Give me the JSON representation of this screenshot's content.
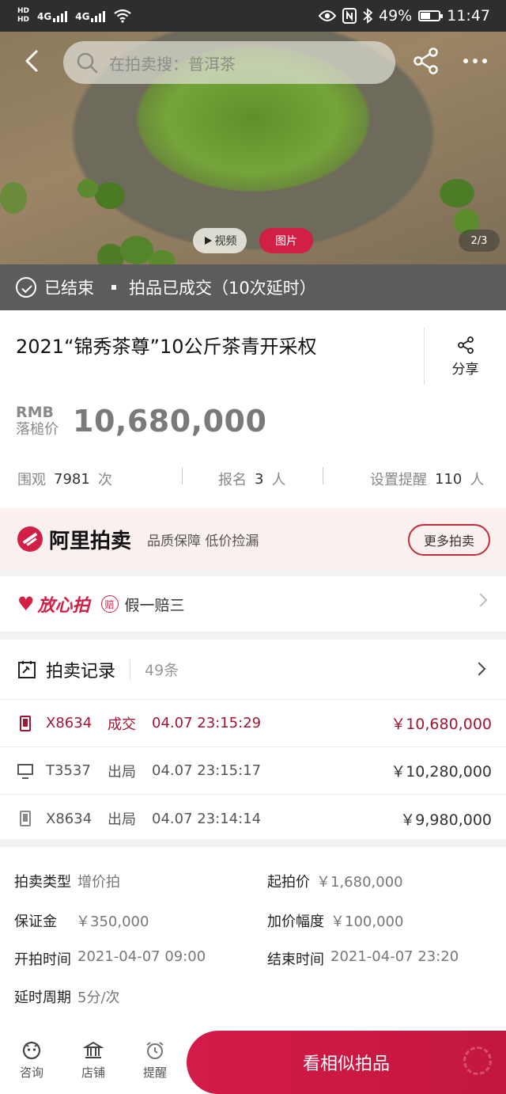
{
  "status_bar": {
    "hd1": "HD",
    "hd2": "HD",
    "net1": "4G",
    "net2": "4G",
    "battery": "49%",
    "time": "11:47"
  },
  "hero": {
    "search_placeholder": "在拍卖搜：普洱茶",
    "video_tab": "视频",
    "photo_tab": "图片",
    "image_counter": "2/3",
    "ended_label": "已结束",
    "deal_label": "拍品已成交（10次延时）"
  },
  "lot": {
    "title": "2021“锦秀茶尊”10公斤茶青开采权",
    "share_label": "分享",
    "currency": "RMB",
    "price_label": "落槌价",
    "price": "10,680,000",
    "stats": [
      {
        "label": "围观",
        "value": "7981",
        "unit": "次"
      },
      {
        "label": "报名",
        "value": "3",
        "unit": "人"
      },
      {
        "label": "设置提醒",
        "value": "110",
        "unit": "人"
      }
    ]
  },
  "ali_banner": {
    "name": "阿里拍卖",
    "tagline": "品质保障 低价捡漏",
    "more_button": "更多拍卖"
  },
  "guarantee": {
    "name": "放心拍",
    "badge": "赔",
    "text": "假一赔三"
  },
  "records": {
    "title": "拍卖记录",
    "count": "49条",
    "rows": [
      {
        "device": "phone",
        "user": "X8634",
        "status": "成交",
        "time": "04.07 23:15:29",
        "amount": "￥10,680,000"
      },
      {
        "device": "pc",
        "user": "T3537",
        "status": "出局",
        "time": "04.07 23:15:17",
        "amount": "￥10,280,000"
      },
      {
        "device": "phone",
        "user": "X8634",
        "status": "出局",
        "time": "04.07 23:14:14",
        "amount": "￥9,980,000"
      }
    ]
  },
  "details": {
    "type_label": "拍卖类型",
    "type_value": "增价拍",
    "start_price_label": "起拍价",
    "start_price_value": "￥1,680,000",
    "deposit_label": "保证金",
    "deposit_value": "￥350,000",
    "increment_label": "加价幅度",
    "increment_value": "￥100,000",
    "start_time_label": "开拍时间",
    "start_time_value": "2021-04-07 09:00",
    "end_time_label": "结束时间",
    "end_time_value": "2021-04-07 23:20",
    "delay_label": "延时周期",
    "delay_value": "5分/次"
  },
  "bottom_bar": {
    "consult": "咨询",
    "shop": "店铺",
    "remind": "提醒",
    "cta": "看相似拍品"
  },
  "colors": {
    "accent": "#d11f45",
    "win_text": "#a11632",
    "ended_bar": "#5c5c5e"
  }
}
